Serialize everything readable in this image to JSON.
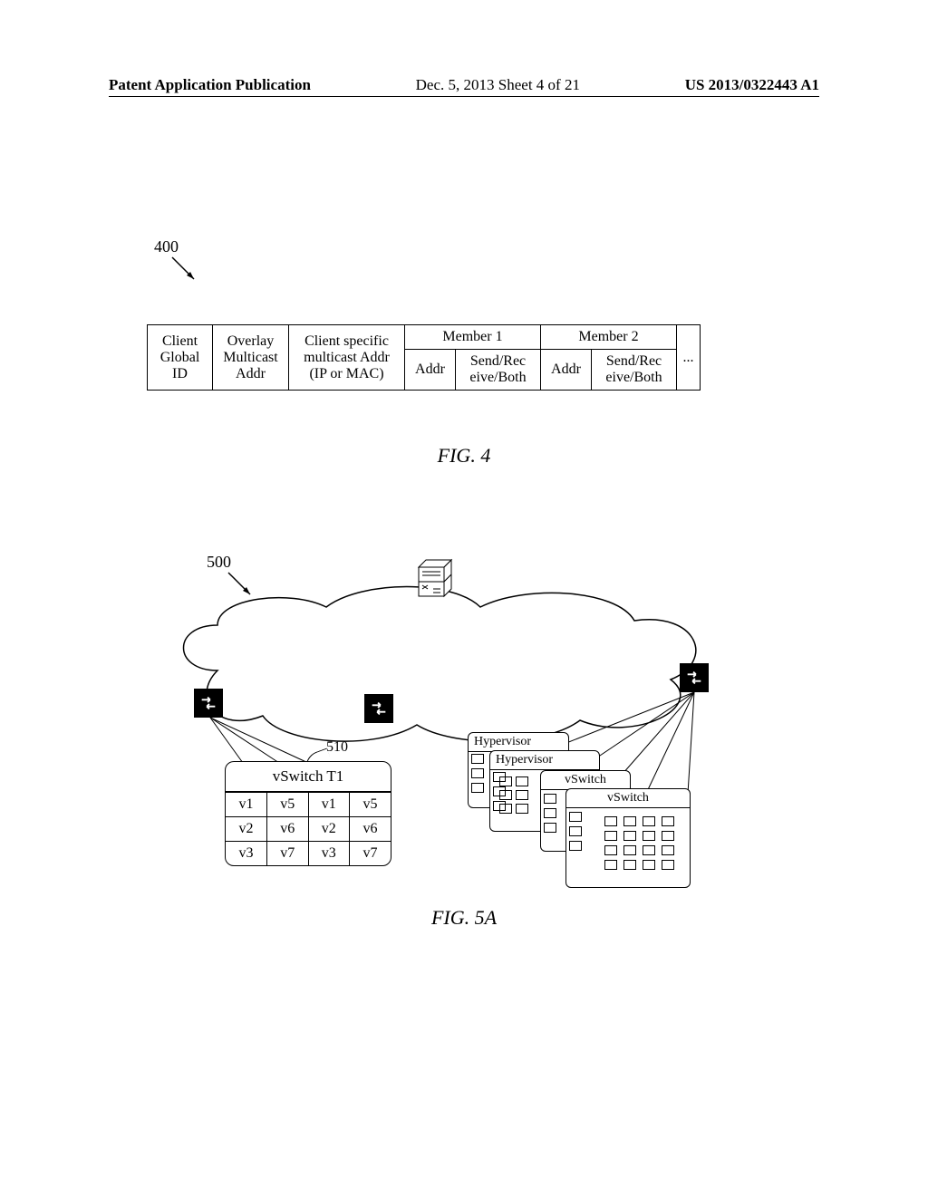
{
  "header": {
    "left": "Patent Application Publication",
    "mid": "Dec. 5, 2013  Sheet 4 of 21",
    "right": "US 2013/0322443 A1"
  },
  "fig4": {
    "ref": "400",
    "label": "FIG. 4",
    "headers": {
      "c1": "Client\nGlobal\nID",
      "c2": "Overlay\nMulticast\nAddr",
      "c3": "Client specific\nmulticast Addr\n(IP or MAC)",
      "m1": "Member 1",
      "m2": "Member 2",
      "dots": "..."
    },
    "row2": {
      "addr": "Addr",
      "srb": "Send/Rec\neive/Both",
      "dots": "..."
    }
  },
  "fig5": {
    "ref": "500",
    "callout": "510",
    "label": "FIG. 5A",
    "vswitch_t1": {
      "title": "vSwitch T1",
      "rows": [
        [
          "v1",
          "v5",
          "v1",
          "v5"
        ],
        [
          "v2",
          "v6",
          "v2",
          "v6"
        ],
        [
          "v3",
          "v7",
          "v3",
          "v7"
        ]
      ]
    },
    "stack": {
      "hyp1": "Hypervisor",
      "hyp2": "Hypervisor",
      "vs1": "vSwitch",
      "vs2": "vSwitch"
    }
  },
  "chart_data": {
    "type": "table",
    "title": "FIG. 4 — Multicast address mapping table (header layout, no data rows shown)",
    "columns": [
      "Client Global ID",
      "Overlay Multicast Addr",
      "Client specific multicast Addr (IP or MAC)",
      "Member 1 / Addr",
      "Member 1 / Send/Receive/Both",
      "Member 2 / Addr",
      "Member 2 / Send/Receive/Both",
      "..."
    ],
    "rows": []
  }
}
